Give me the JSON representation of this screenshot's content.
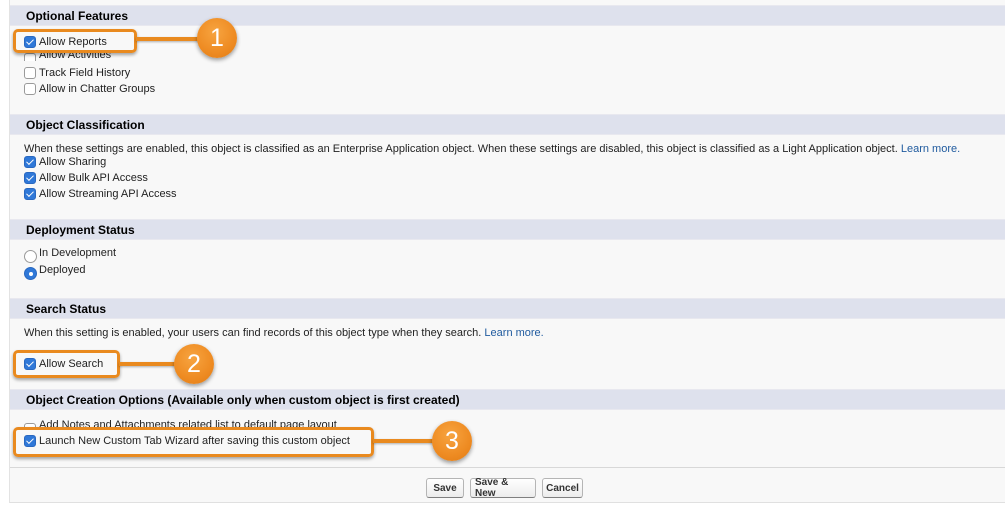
{
  "sections": {
    "optional_features": {
      "title": "Optional Features",
      "items": [
        {
          "label": "Allow Reports",
          "checked": true
        },
        {
          "label": "Allow Activities",
          "checked": false
        },
        {
          "label": "Track Field History",
          "checked": false
        },
        {
          "label": "Allow in Chatter Groups",
          "checked": false
        }
      ]
    },
    "object_classification": {
      "title": "Object Classification",
      "description": "When these settings are enabled, this object is classified as an Enterprise Application object. When these settings are disabled, this object is classified as a Light Application object.",
      "learn_more": "Learn more.",
      "items": [
        {
          "label": "Allow Sharing",
          "checked": true
        },
        {
          "label": "Allow Bulk API Access",
          "checked": true
        },
        {
          "label": "Allow Streaming API Access",
          "checked": true
        }
      ]
    },
    "deployment_status": {
      "title": "Deployment Status",
      "options": [
        {
          "label": "In Development",
          "selected": false
        },
        {
          "label": "Deployed",
          "selected": true
        }
      ]
    },
    "search_status": {
      "title": "Search Status",
      "description": "When this setting is enabled, your users can find records of this object type when they search.",
      "learn_more": "Learn more.",
      "items": [
        {
          "label": "Allow Search",
          "checked": true
        }
      ]
    },
    "object_creation_options": {
      "title": "Object Creation Options (Available only when custom object is first created)",
      "items": [
        {
          "label": "Add Notes and Attachments related list to default page layout",
          "checked": false
        },
        {
          "label": "Launch New Custom Tab Wizard after saving this custom object",
          "checked": true
        }
      ]
    }
  },
  "callouts": [
    "1",
    "2",
    "3"
  ],
  "buttons": {
    "save": "Save",
    "save_new": "Save & New",
    "cancel": "Cancel"
  },
  "colors": {
    "accent_orange": "#e98a1f",
    "checkbox_blue": "#2f78d8",
    "link_blue": "#1f5a9e",
    "section_header_bg": "#dee1ed"
  }
}
